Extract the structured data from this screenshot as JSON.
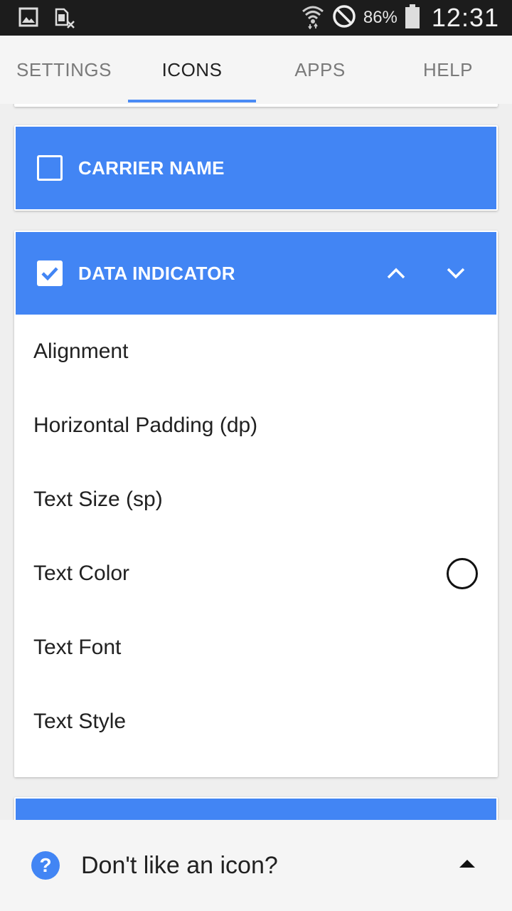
{
  "status_bar": {
    "battery_percent": "86%",
    "time": "12:31",
    "icons": [
      "gallery-icon",
      "sim-blocked-icon",
      "wifi-icon",
      "do-not-disturb-icon",
      "battery-icon"
    ]
  },
  "tabs": [
    {
      "label": "SETTINGS",
      "active": false
    },
    {
      "label": "ICONS",
      "active": true
    },
    {
      "label": "APPS",
      "active": false
    },
    {
      "label": "HELP",
      "active": false
    }
  ],
  "cards": {
    "carrier": {
      "label": "CARRIER NAME",
      "checked": false
    },
    "data_indicator": {
      "label": "DATA INDICATOR",
      "checked": true,
      "items": [
        {
          "label": "Alignment"
        },
        {
          "label": "Horizontal Padding (dp)"
        },
        {
          "label": "Text Size (sp)"
        },
        {
          "label": "Text Color"
        },
        {
          "label": "Text Font"
        },
        {
          "label": "Text Style"
        }
      ]
    }
  },
  "bottom_bar": {
    "text": "Don't like an icon?",
    "help_glyph": "?"
  },
  "colors": {
    "accent": "#4285f4",
    "tab_indicator": "#4a8bf5",
    "status_bar": "#1c1c1c"
  }
}
